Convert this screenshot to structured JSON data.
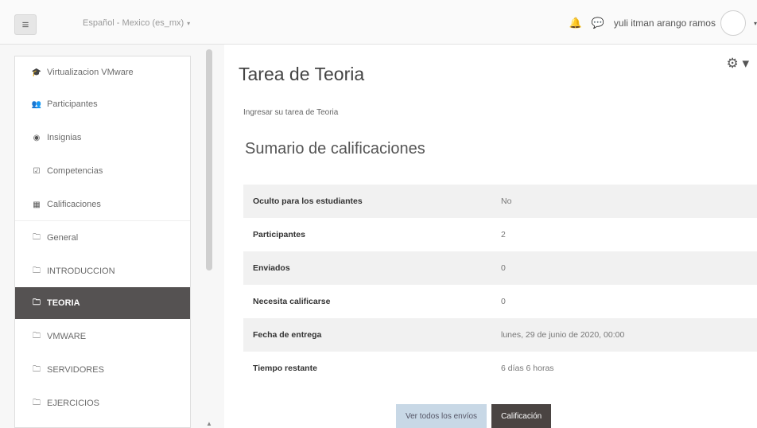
{
  "navbar": {
    "menu_icon": "hamburger-icon",
    "language": "Español - Mexico (es_mx)",
    "language_caret": "▾",
    "notifications_icon": "bell-icon",
    "messages_icon": "chat-icon",
    "user_name": "yuli itman arango ramos",
    "user_caret": "▾"
  },
  "sidebar": {
    "items": [
      {
        "icon": "graduation-cap-icon",
        "glyph": "🎓",
        "label": "Virtualizacion VMware"
      },
      {
        "icon": "users-icon",
        "glyph": "👥",
        "label": "Participantes"
      },
      {
        "icon": "badge-icon",
        "glyph": "◉",
        "label": "Insignias"
      },
      {
        "icon": "check-square-icon",
        "glyph": "☑",
        "label": "Competencias"
      },
      {
        "icon": "table-icon",
        "glyph": "▦",
        "label": "Calificaciones"
      },
      {
        "icon": "folder-icon",
        "glyph": "🗀",
        "label": "General"
      },
      {
        "icon": "folder-icon",
        "glyph": "🗀",
        "label": "INTRODUCCION"
      },
      {
        "icon": "folder-icon",
        "glyph": "🗀",
        "label": "TEORIA"
      },
      {
        "icon": "folder-icon",
        "glyph": "🗀",
        "label": "VMWARE"
      },
      {
        "icon": "folder-icon",
        "glyph": "🗀",
        "label": "SERVIDORES"
      },
      {
        "icon": "folder-icon",
        "glyph": "🗀",
        "label": "EJERCICIOS"
      }
    ],
    "active_index": 7
  },
  "main": {
    "settings_icon": "gear-icon",
    "title": "Tarea de Teoria",
    "intro": "Ingresar su tarea de Teoria",
    "summary_title": "Sumario de calificaciones",
    "summary_rows": [
      {
        "label": "Oculto para los estudiantes",
        "value": "No"
      },
      {
        "label": "Participantes",
        "value": "2"
      },
      {
        "label": "Enviados",
        "value": "0"
      },
      {
        "label": "Necesita calificarse",
        "value": "0"
      },
      {
        "label": "Fecha de entrega",
        "value": "lunes, 29 de junio de 2020, 00:00"
      },
      {
        "label": "Tiempo restante",
        "value": "6 días 6 horas"
      }
    ],
    "buttons": {
      "view_all": "Ver todos los envíos",
      "grade": "Calificación"
    }
  },
  "colors": {
    "active_sidebar": "#555252",
    "primary_button": "#4a4442",
    "secondary_button": "#c8d8e6"
  }
}
